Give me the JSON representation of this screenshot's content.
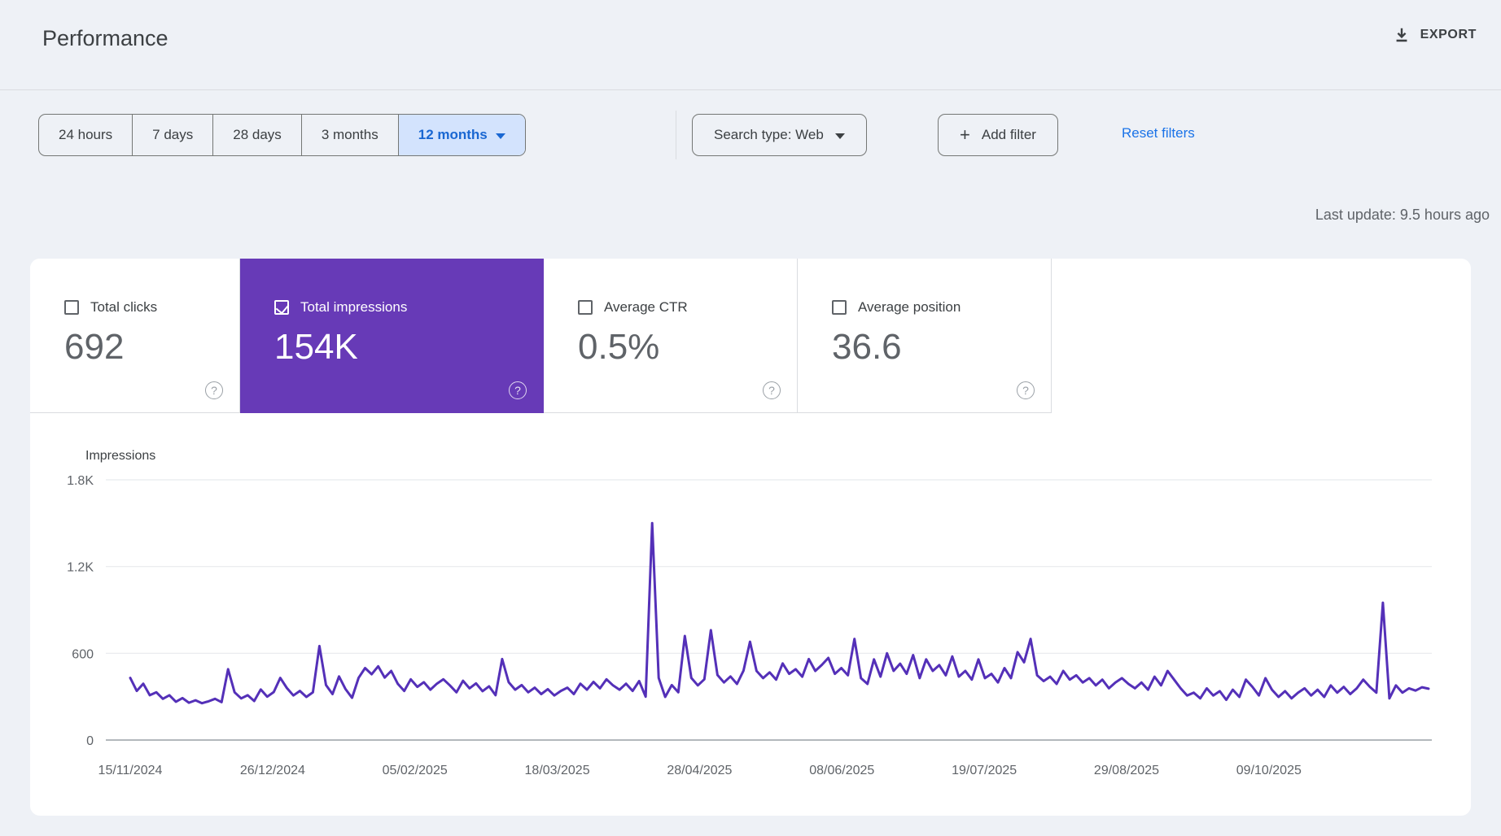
{
  "header": {
    "title": "Performance",
    "export_label": "EXPORT"
  },
  "filters": {
    "date_ranges": [
      "24 hours",
      "7 days",
      "28 days",
      "3 months",
      "12 months"
    ],
    "selected_range": "12 months",
    "search_type_label": "Search type: Web",
    "add_filter_label": "Add filter",
    "reset_label": "Reset filters"
  },
  "last_update": "Last update: 9.5 hours ago",
  "icons": {
    "plus": "+",
    "help": "?"
  },
  "cards": [
    {
      "label": "Total clicks",
      "value": "692",
      "checked": false,
      "selected": false
    },
    {
      "label": "Total impressions",
      "value": "154K",
      "checked": true,
      "selected": true
    },
    {
      "label": "Average CTR",
      "value": "0.5%",
      "checked": false,
      "selected": false
    },
    {
      "label": "Average position",
      "value": "36.6",
      "checked": false,
      "selected": false
    }
  ],
  "colors": {
    "accent_purple": "#673ab7",
    "line_purple": "#5430b8",
    "selected_tab_bg": "#d3e3fd",
    "selected_tab_text": "#1967d2",
    "link_blue": "#1a73e8",
    "grid_line": "#e8eaed",
    "axis_line": "#9aa0a6",
    "text_secondary": "#5f6368"
  },
  "chart_data": {
    "type": "line",
    "title": "Impressions",
    "ylim": [
      0,
      1800
    ],
    "grid": true,
    "legend": "none",
    "y_ticks": [
      {
        "v": 0,
        "label": "0"
      },
      {
        "v": 600,
        "label": "600"
      },
      {
        "v": 1200,
        "label": "1.2K"
      },
      {
        "v": 1800,
        "label": "1.8K"
      }
    ],
    "x_tick_labels": [
      "15/11/2024",
      "26/12/2024",
      "05/02/2025",
      "18/03/2025",
      "28/04/2025",
      "08/06/2025",
      "19/07/2025",
      "29/08/2025",
      "09/10/2025"
    ],
    "x_tick_day_offsets": [
      0,
      41,
      82,
      123,
      164,
      205,
      246,
      287,
      328
    ],
    "total_days": 374,
    "series": [
      {
        "name": "Impressions",
        "values": [
          430,
          340,
          390,
          310,
          330,
          285,
          310,
          265,
          290,
          258,
          275,
          255,
          268,
          285,
          262,
          490,
          330,
          288,
          310,
          270,
          350,
          300,
          332,
          430,
          360,
          308,
          340,
          298,
          330,
          650,
          380,
          318,
          440,
          352,
          292,
          430,
          498,
          455,
          510,
          432,
          478,
          390,
          340,
          420,
          368,
          400,
          348,
          390,
          420,
          378,
          330,
          410,
          358,
          392,
          338,
          372,
          310,
          560,
          400,
          348,
          380,
          330,
          362,
          318,
          352,
          308,
          340,
          362,
          318,
          390,
          348,
          402,
          358,
          420,
          378,
          348,
          390,
          340,
          408,
          300,
          1500,
          430,
          298,
          380,
          330,
          720,
          430,
          378,
          420,
          760,
          450,
          398,
          440,
          388,
          480,
          680,
          478,
          428,
          468,
          418,
          530,
          458,
          490,
          438,
          560,
          478,
          520,
          568,
          458,
          498,
          448,
          700,
          428,
          388,
          558,
          438,
          600,
          478,
          528,
          458,
          588,
          428,
          558,
          478,
          518,
          448,
          578,
          438,
          478,
          418,
          558,
          428,
          458,
          398,
          498,
          428,
          608,
          538,
          700,
          448,
          408,
          438,
          388,
          478,
          418,
          448,
          398,
          428,
          378,
          418,
          358,
          398,
          428,
          388,
          358,
          398,
          348,
          438,
          378,
          478,
          418,
          358,
          308,
          328,
          288,
          358,
          308,
          338,
          278,
          348,
          298,
          418,
          368,
          308,
          428,
          348,
          298,
          338,
          288,
          328,
          358,
          308,
          348,
          298,
          378,
          328,
          368,
          318,
          358,
          418,
          368,
          328,
          950,
          288,
          378,
          328,
          358,
          342,
          365,
          355
        ]
      }
    ]
  }
}
